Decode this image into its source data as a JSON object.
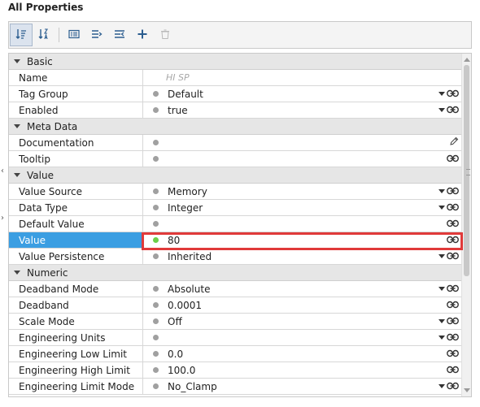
{
  "header": {
    "title": "All Properties"
  },
  "toolbar": {
    "buttons": [
      {
        "icon": "sort-categorized-icon",
        "active": true
      },
      {
        "icon": "sort-alpha-icon",
        "active": false
      },
      {
        "icon": "details-icon",
        "active": false
      },
      {
        "icon": "expand-all-icon",
        "active": false
      },
      {
        "icon": "collapse-all-icon",
        "active": false
      },
      {
        "icon": "add-icon",
        "active": false
      },
      {
        "icon": "delete-icon",
        "active": false
      }
    ]
  },
  "sections": [
    {
      "label": "Basic",
      "rows": [
        {
          "name": "Name",
          "value": "",
          "placeholder": "HI SP",
          "dot": false,
          "dropdown": false,
          "icon": "none"
        },
        {
          "name": "Tag Group",
          "value": "Default",
          "dot": "gray",
          "dropdown": true,
          "icon": "link"
        },
        {
          "name": "Enabled",
          "value": "true",
          "dot": "gray",
          "dropdown": true,
          "icon": "link"
        }
      ]
    },
    {
      "label": "Meta Data",
      "rows": [
        {
          "name": "Documentation",
          "value": "",
          "dot": "gray",
          "dropdown": false,
          "icon": "pencil"
        },
        {
          "name": "Tooltip",
          "value": "",
          "dot": "gray",
          "dropdown": false,
          "icon": "link"
        }
      ]
    },
    {
      "label": "Value",
      "rows": [
        {
          "name": "Value Source",
          "value": "Memory",
          "dot": "gray",
          "dropdown": true,
          "icon": "link"
        },
        {
          "name": "Data Type",
          "value": "Integer",
          "dot": "gray",
          "dropdown": true,
          "icon": "link"
        },
        {
          "name": "Default Value",
          "value": "",
          "dot": "gray",
          "dropdown": false,
          "icon": "link"
        },
        {
          "name": "Value",
          "value": "80",
          "dot": "green",
          "dropdown": false,
          "icon": "link",
          "selected": true
        },
        {
          "name": "Value Persistence",
          "value": "Inherited",
          "dot": "gray",
          "dropdown": true,
          "icon": "link"
        }
      ]
    },
    {
      "label": "Numeric",
      "rows": [
        {
          "name": "Deadband Mode",
          "value": "Absolute",
          "dot": "gray",
          "dropdown": true,
          "icon": "link"
        },
        {
          "name": "Deadband",
          "value": "0.0001",
          "dot": "gray",
          "dropdown": false,
          "icon": "link"
        },
        {
          "name": "Scale Mode",
          "value": "Off",
          "dot": "gray",
          "dropdown": true,
          "icon": "link"
        },
        {
          "name": "Engineering Units",
          "value": "",
          "dot": "gray",
          "dropdown": true,
          "icon": "link"
        },
        {
          "name": "Engineering Low Limit",
          "value": "0.0",
          "dot": "gray",
          "dropdown": false,
          "icon": "link"
        },
        {
          "name": "Engineering High Limit",
          "value": "100.0",
          "dot": "gray",
          "dropdown": false,
          "icon": "link"
        },
        {
          "name": "Engineering Limit Mode",
          "value": "No_Clamp",
          "dot": "gray",
          "dropdown": true,
          "icon": "link"
        }
      ]
    }
  ],
  "colors": {
    "selected": "#3b9ee2",
    "highlight": "#e03a3a",
    "dot_active": "#6cd049",
    "dot_default": "#a0a0a0"
  }
}
